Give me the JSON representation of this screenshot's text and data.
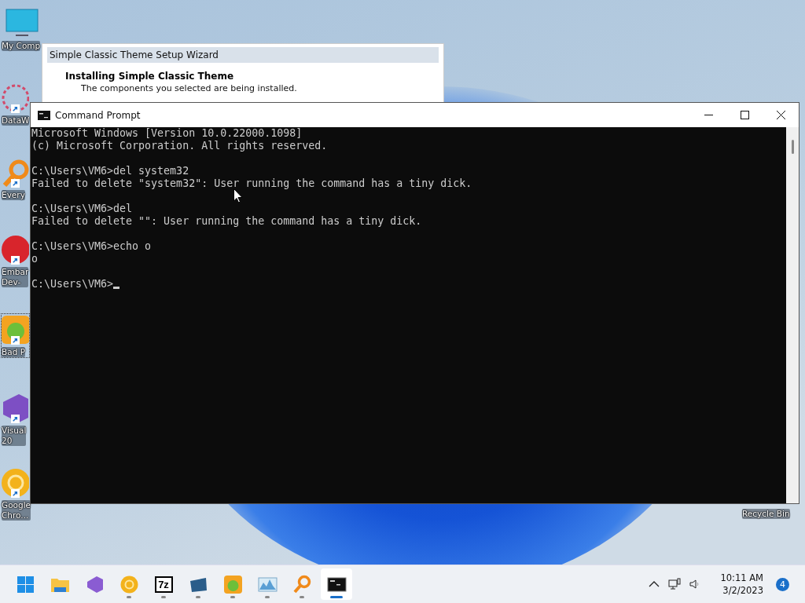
{
  "desktop_icons": [
    {
      "kind": "monitor",
      "lines": [
        "My Comp"
      ],
      "shortcut": false
    },
    {
      "kind": "flower",
      "lines": [
        "DataW"
      ],
      "shortcut": true
    },
    {
      "kind": "magnifier",
      "lines": [
        "Every"
      ],
      "shortcut": true
    },
    {
      "kind": "badge",
      "lines": [
        "Embar",
        "Dev-"
      ],
      "shortcut": true
    },
    {
      "kind": "pig",
      "lines": [
        "Bad P"
      ],
      "shortcut": true,
      "selected": true
    },
    {
      "kind": "vs",
      "lines": [
        "Visual",
        "20"
      ],
      "shortcut": true
    },
    {
      "kind": "chrome",
      "lines": [
        "Google",
        "Chro..."
      ],
      "shortcut": true
    },
    {
      "kind": "bin",
      "lines": [
        "Recycle Bin"
      ],
      "shortcut": false
    }
  ],
  "wizard": {
    "title": "Simple Classic Theme Setup Wizard",
    "heading": "Installing Simple Classic Theme",
    "description": "The components you selected are being installed."
  },
  "console": {
    "title": "Command Prompt",
    "blocks": [
      [
        "Microsoft Windows [Version 10.0.22000.1098]",
        "(c) Microsoft Corporation. All rights reserved."
      ],
      [
        "C:\\Users\\VM6>del system32",
        "Failed to delete \"system32\": User running the command has a tiny dick."
      ],
      [
        "C:\\Users\\VM6>del",
        "Failed to delete \"\": User running the command has a tiny dick."
      ],
      [
        "C:\\Users\\VM6>echo o",
        "o"
      ]
    ],
    "prompt": "C:\\Users\\VM6>",
    "cursor": true
  },
  "taskbar": {
    "apps": [
      {
        "kind": "start",
        "running": false,
        "selected": false
      },
      {
        "kind": "folder",
        "running": false,
        "selected": false
      },
      {
        "kind": "vs",
        "running": false,
        "selected": false
      },
      {
        "kind": "chrome",
        "running": true,
        "selected": false
      },
      {
        "kind": "archive",
        "label": "7z",
        "running": true,
        "selected": false
      },
      {
        "kind": "flag",
        "running": true,
        "selected": false
      },
      {
        "kind": "pig",
        "running": true,
        "selected": false
      },
      {
        "kind": "chart",
        "running": true,
        "selected": false
      },
      {
        "kind": "magnifier",
        "running": true,
        "selected": false
      },
      {
        "kind": "terminal",
        "running": true,
        "selected": true
      }
    ],
    "time": "10:11 AM",
    "date": "3/2/2023",
    "notifications": "4"
  }
}
